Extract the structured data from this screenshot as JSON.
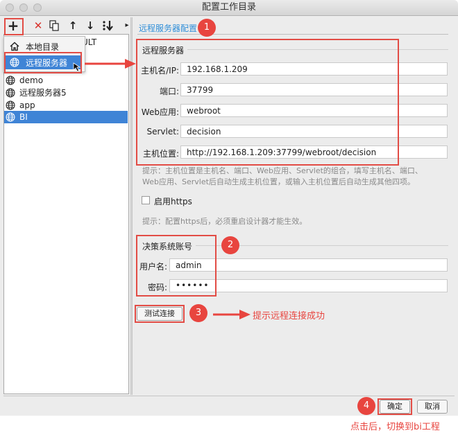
{
  "window": {
    "title": "配置工作目录"
  },
  "toolbar": {
    "add_icon": "+",
    "delete_icon": "✕",
    "copy_icon": "copy",
    "up_icon": "↑",
    "down_icon": "↓",
    "sort_icon": "sort"
  },
  "tree": {
    "items": [
      {
        "label": "ULT",
        "icon": "folder"
      },
      {
        "label": "demo",
        "icon": "globe"
      },
      {
        "label": "远程服务器5",
        "icon": "globe"
      },
      {
        "label": "app",
        "icon": "globe"
      },
      {
        "label": "BI",
        "icon": "globe"
      }
    ]
  },
  "popup_menu": {
    "local": "本地目录",
    "remote": "远程服务器"
  },
  "config": {
    "header": "远程服务器配置",
    "remote_group": "远程服务器",
    "host_label": "主机名/IP:",
    "host_value": "192.168.1.209",
    "port_label": "端口:",
    "port_value": "37799",
    "webapp_label": "Web应用:",
    "webapp_value": "webroot",
    "servlet_label": "Servlet:",
    "servlet_value": "decision",
    "location_label": "主机位置:",
    "location_value": "http://192.168.1.209:37799/webroot/decision",
    "hint1_line1": "提示：主机位置是主机名、端口、Web应用、Servlet的组合，填写主机名、端口、",
    "hint1_line2": "Web应用、Servlet后自动生成主机位置，或输入主机位置后自动生成其他四项。",
    "https_label": "启用https",
    "hint2": "提示：配置https后，必须重启设计器才能生效。",
    "account_group": "决策系统账号",
    "user_label": "用户名:",
    "user_value": "admin",
    "pwd_label": "密码:",
    "pwd_value": "••••••",
    "test_button": "测试连接"
  },
  "footer": {
    "ok": "确定",
    "cancel": "取消"
  },
  "annotations": {
    "badges": [
      "1",
      "2",
      "3",
      "4"
    ],
    "tip_success": "提示远程连接成功",
    "tip_switch": "点击后，切换到bi工程",
    "accent": "#e8453f"
  }
}
